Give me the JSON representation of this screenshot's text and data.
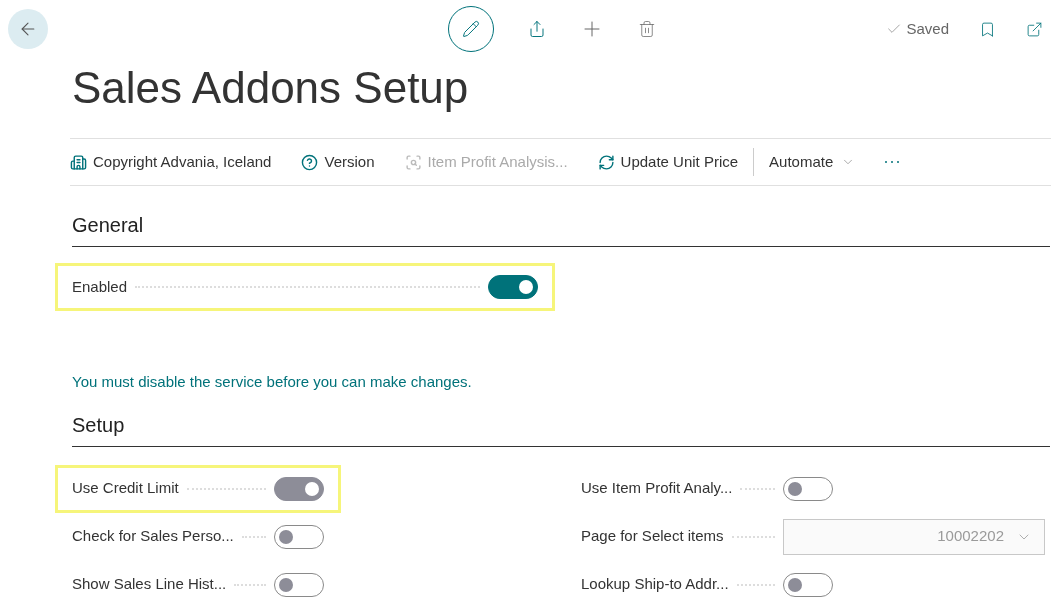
{
  "header": {
    "status": "Saved"
  },
  "title": "Sales Addons Setup",
  "actions": [
    {
      "label": "Copyright Advania, Iceland",
      "kind": "building",
      "disabled": false
    },
    {
      "label": "Version",
      "kind": "help",
      "disabled": false
    },
    {
      "label": "Item Profit Analysis...",
      "kind": "analysis",
      "disabled": true
    },
    {
      "label": "Update Unit Price",
      "kind": "update",
      "disabled": false
    },
    {
      "label": "Automate",
      "kind": "menu",
      "disabled": false
    }
  ],
  "general": {
    "heading": "General",
    "fields": [
      {
        "label": "Enabled",
        "kind": "toggle",
        "on": true,
        "disabled": false,
        "highlighted": true
      }
    ]
  },
  "message": "You must disable the service before you can make changes.",
  "setup": {
    "heading": "Setup",
    "columns": [
      {
        "fields": [
          {
            "label": "Use Credit Limit",
            "kind": "toggle",
            "on": true,
            "disabled": true,
            "highlighted": true
          },
          {
            "label": "Check for Sales Perso...",
            "kind": "toggle",
            "on": false,
            "highlighted": false
          },
          {
            "label": "Show Sales Line Hist...",
            "kind": "toggle",
            "on": false,
            "highlighted": false
          }
        ]
      },
      {
        "fields": [
          {
            "label": "Use Item Profit Analy...",
            "kind": "toggle",
            "on": false,
            "highlighted": false
          },
          {
            "label": "Page for Select items",
            "kind": "select",
            "value": "10002202",
            "disabled": true,
            "highlighted": false
          },
          {
            "label": "Lookup Ship-to Addr...",
            "kind": "toggle",
            "on": false,
            "highlighted": false
          }
        ]
      }
    ]
  }
}
